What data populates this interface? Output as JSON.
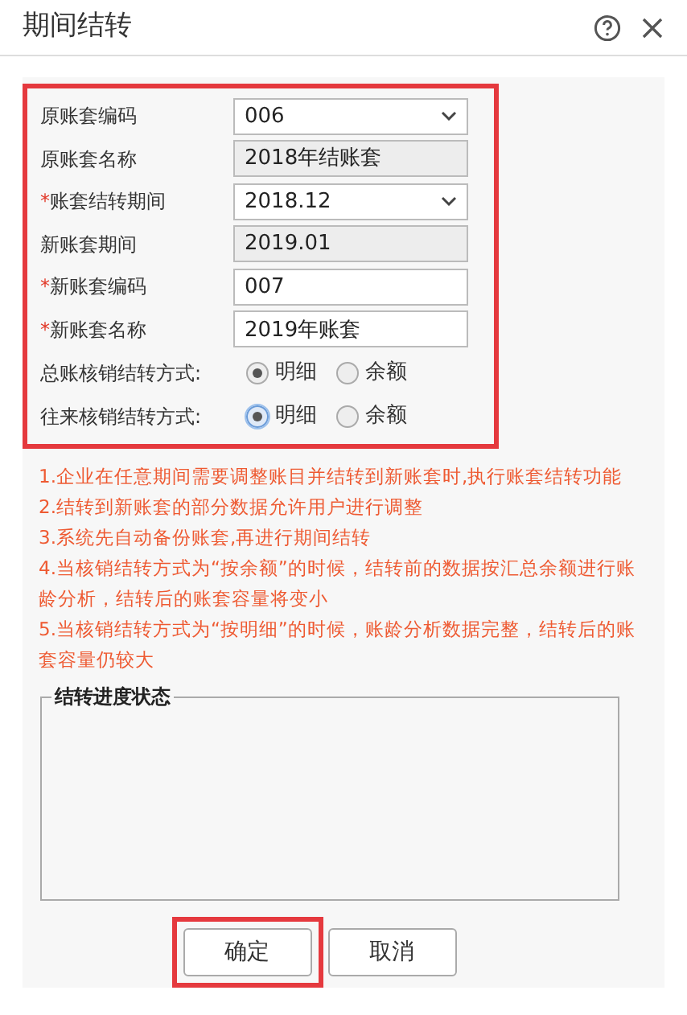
{
  "window": {
    "title": "期间结转"
  },
  "form": {
    "highlighted": true,
    "fields": [
      {
        "kind": "select",
        "label": "原账套编码",
        "value": "006"
      },
      {
        "kind": "readonly",
        "label": "原账套名称",
        "value": "2018年结账套"
      },
      {
        "kind": "select",
        "required_mark": "*",
        "label": "账套结转期间",
        "value": "2018.12"
      },
      {
        "kind": "readonly",
        "label": "新账套期间",
        "value": "2019.01"
      },
      {
        "kind": "input",
        "required_mark": "*",
        "label": "新账套编码",
        "value": "007"
      },
      {
        "kind": "input",
        "required_mark": "*",
        "label": "新账套名称",
        "value": "2019年账套"
      },
      {
        "kind": "radio",
        "label": "总账核销结转方式:",
        "focused": false,
        "options": [
          {
            "label": "明细",
            "selected": true
          },
          {
            "label": "余额",
            "selected": false
          }
        ]
      },
      {
        "kind": "radio",
        "label": "往来核销结转方式:",
        "focused": true,
        "options": [
          {
            "label": "明细",
            "selected": true
          },
          {
            "label": "余额",
            "selected": false
          }
        ]
      }
    ]
  },
  "notes": [
    "1.企业在任意期间需要调整账目并结转到新账套时,执行账套结转功能",
    "2.结转到新账套的部分数据允许用户进行调整",
    "3.系统先自动备份账套,再进行期间结转",
    "4.当核销结转方式为“按余额”的时候，结转前的数据按汇总余额进行账龄分析，结转后的账套容量将变小",
    "5.当核销结转方式为“按明细”的时候，账龄分析数据完整，结转后的账套容量仍较大"
  ],
  "progress": {
    "title": "结转进度状态"
  },
  "buttons": [
    {
      "label": "确定",
      "highlighted": true
    },
    {
      "label": "取消",
      "highlighted": false
    }
  ]
}
